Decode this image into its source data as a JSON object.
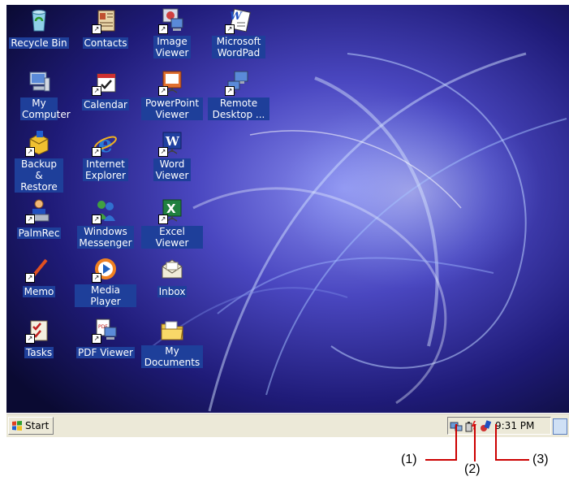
{
  "desktop": {
    "icons": [
      {
        "label": "Recycle Bin",
        "icon": "recycle-bin-icon"
      },
      {
        "label": "Contacts",
        "icon": "contacts-icon"
      },
      {
        "label": "Image Viewer",
        "icon": "image-viewer-icon"
      },
      {
        "label": "Microsoft WordPad",
        "icon": "wordpad-icon"
      },
      {
        "label": "My Computer",
        "icon": "my-computer-icon"
      },
      {
        "label": "Calendar",
        "icon": "calendar-icon"
      },
      {
        "label": "PowerPoint Viewer",
        "icon": "powerpoint-viewer-icon"
      },
      {
        "label": "Remote Desktop ...",
        "icon": "remote-desktop-icon"
      },
      {
        "label": "Backup & Restore",
        "icon": "backup-restore-icon"
      },
      {
        "label": "Internet Explorer",
        "icon": "internet-explorer-icon"
      },
      {
        "label": "Word Viewer",
        "icon": "word-viewer-icon"
      },
      {
        "label": "PalmRec",
        "icon": "palmrec-icon"
      },
      {
        "label": "Windows Messenger",
        "icon": "messenger-icon"
      },
      {
        "label": "Excel Viewer",
        "icon": "excel-viewer-icon"
      },
      {
        "label": "Memo",
        "icon": "memo-icon"
      },
      {
        "label": "Media Player",
        "icon": "media-player-icon"
      },
      {
        "label": "Inbox",
        "icon": "inbox-icon"
      },
      {
        "label": "Tasks",
        "icon": "tasks-icon"
      },
      {
        "label": "PDF Viewer",
        "icon": "pdf-viewer-icon"
      },
      {
        "label": "My Documents",
        "icon": "my-documents-icon"
      }
    ]
  },
  "taskbar": {
    "start_label": "Start",
    "clock": "9:31 PM",
    "tray_icons": [
      "network-icon",
      "battery-power-icon",
      "volume-icon"
    ]
  },
  "callouts": {
    "c1": "(1)",
    "c2": "(2)",
    "c3": "(3)"
  },
  "colors": {
    "label_bg": "#1e3f9a",
    "taskbar_bg": "#ece9d8",
    "callout_line": "#cc0000"
  }
}
